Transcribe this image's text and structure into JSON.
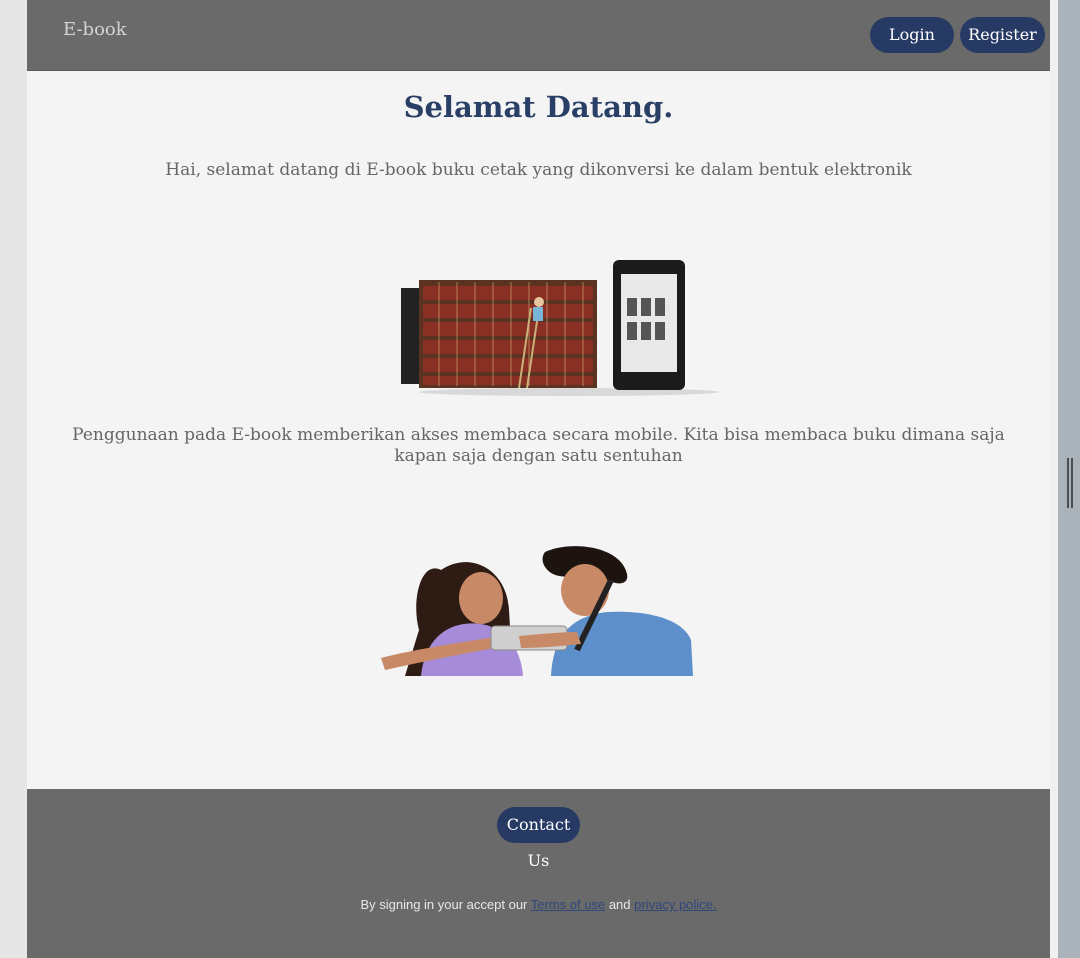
{
  "navbar": {
    "brand": "E-book",
    "login_label": "Login",
    "register_label": "Register"
  },
  "main": {
    "title": "Selamat Datang.",
    "intro": "Hai, selamat datang di E-book buku cetak yang dikonversi ke dalam bentuk elektronik",
    "description": "Penggunaan pada E-book memberikan akses membaca secara mobile. Kita bisa membaca buku dimana saja kapan saja dengan satu sentuhan"
  },
  "footer": {
    "contact_label": "Contact Us",
    "legal_prefix": "By signing in your accept our",
    "terms_link": "Terms of use",
    "legal_and": "and",
    "privacy_link": "privacy police."
  },
  "colors": {
    "navbar_bg": "#6a6a6a",
    "button_bg": "#263a64",
    "title": "#2a3f66"
  },
  "icons": [
    "bookshelf-ereader-illustration",
    "students-with-tablet-photo",
    "scrollbar-grip-icon"
  ]
}
